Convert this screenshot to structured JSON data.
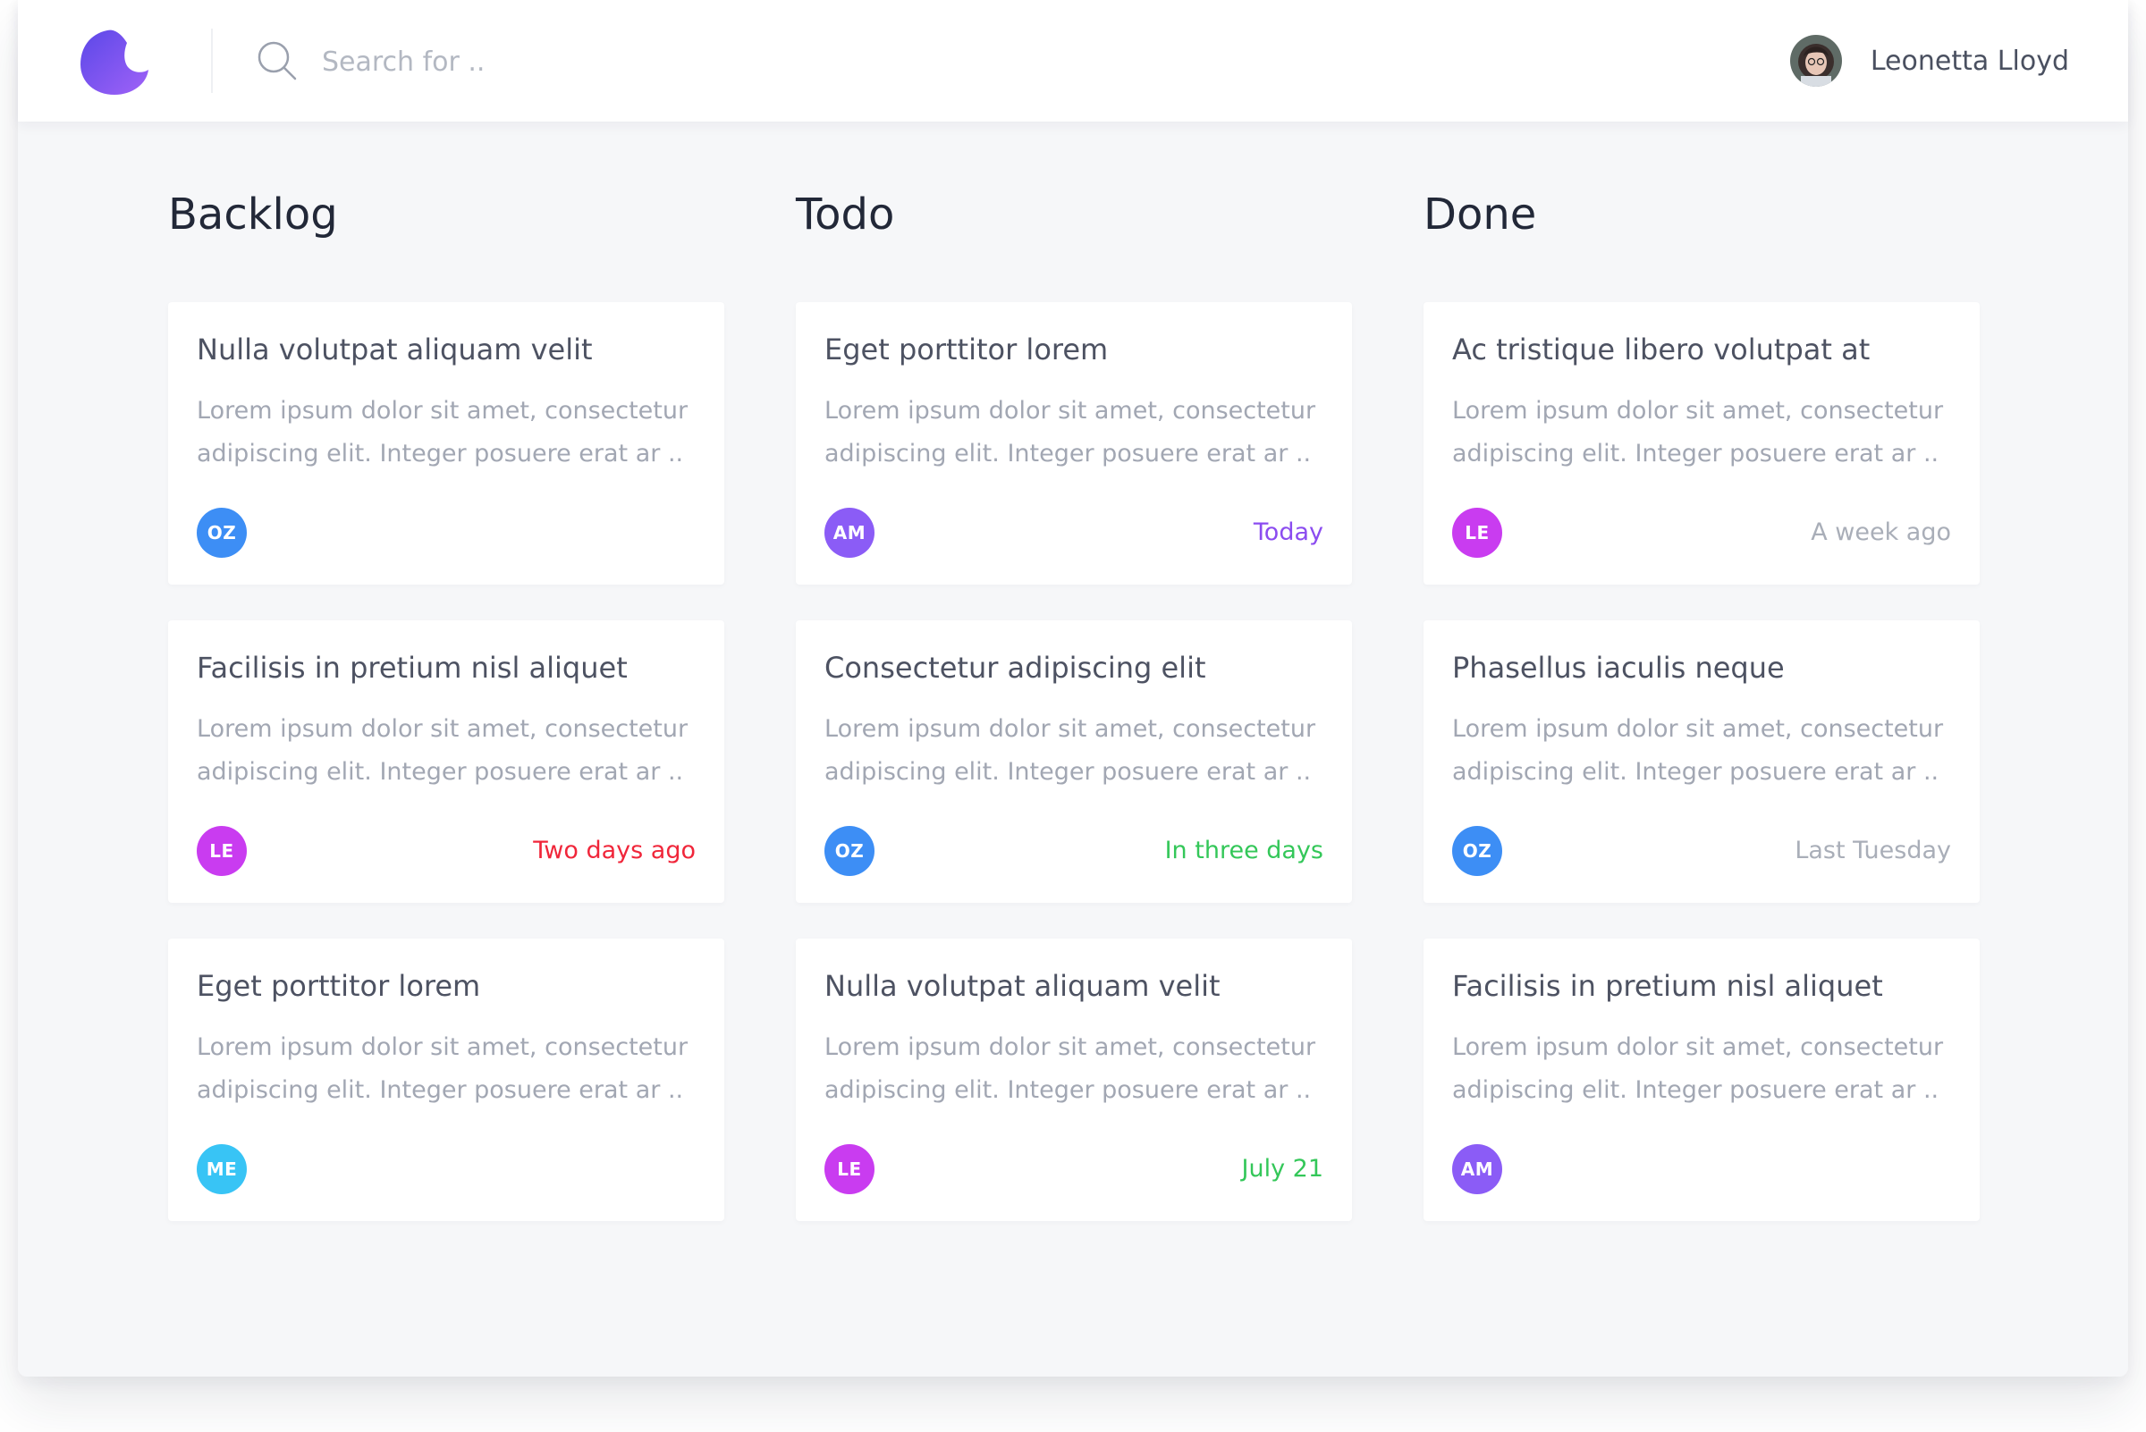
{
  "header": {
    "search_placeholder": "Search for ..",
    "user_name": "Leonetta Lloyd"
  },
  "colors": {
    "logo_gradient": [
      "#5b48e8",
      "#9a60f6"
    ],
    "avatar_oz": "#3d8ef5",
    "avatar_am": "#8b5cf6",
    "avatar_le": "#c93cf0",
    "avatar_me": "#38c4f5",
    "due_purple": "#8b4cf0",
    "due_red": "#f0263a",
    "due_green": "#34c759",
    "due_gray": "#a9aeb8"
  },
  "columns": [
    {
      "title": "Backlog",
      "cards": [
        {
          "title": "Nulla volutpat aliquam velit",
          "body": "Lorem ipsum dolor sit amet, consectetur adipiscing elit. Integer posuere erat ar ..",
          "assignee": "OZ",
          "due": ""
        },
        {
          "title": "Facilisis in pretium nisl aliquet",
          "body": "Lorem ipsum dolor sit amet, consectetur adipiscing elit. Integer posuere erat ar ..",
          "assignee": "LE",
          "due": "Two days ago"
        },
        {
          "title": "Eget porttitor lorem",
          "body": "Lorem ipsum dolor sit amet, consectetur adipiscing elit. Integer posuere erat ar ..",
          "assignee": "ME",
          "due": ""
        }
      ]
    },
    {
      "title": "Todo",
      "cards": [
        {
          "title": "Eget porttitor lorem",
          "body": "Lorem ipsum dolor sit amet, consectetur adipiscing elit. Integer posuere erat ar ..",
          "assignee": "AM",
          "due": "Today"
        },
        {
          "title": "Consectetur adipiscing elit",
          "body": "Lorem ipsum dolor sit amet, consectetur adipiscing elit. Integer posuere erat ar ..",
          "assignee": "OZ",
          "due": "In three days"
        },
        {
          "title": "Nulla volutpat aliquam velit",
          "body": "Lorem ipsum dolor sit amet, consectetur adipiscing elit. Integer posuere erat ar ..",
          "assignee": "LE",
          "due": "July 21"
        }
      ]
    },
    {
      "title": "Done",
      "cards": [
        {
          "title": "Ac tristique libero volutpat at",
          "body": "Lorem ipsum dolor sit amet, consectetur adipiscing elit. Integer posuere erat ar ..",
          "assignee": "LE",
          "due": "A week ago"
        },
        {
          "title": "Phasellus iaculis neque",
          "body": "Lorem ipsum dolor sit amet, consectetur adipiscing elit. Integer posuere erat ar ..",
          "assignee": "OZ",
          "due": "Last Tuesday"
        },
        {
          "title": "Facilisis in pretium nisl aliquet",
          "body": "Lorem ipsum dolor sit amet, consectetur adipiscing elit. Integer posuere erat ar ..",
          "assignee": "AM",
          "due": ""
        }
      ]
    }
  ]
}
